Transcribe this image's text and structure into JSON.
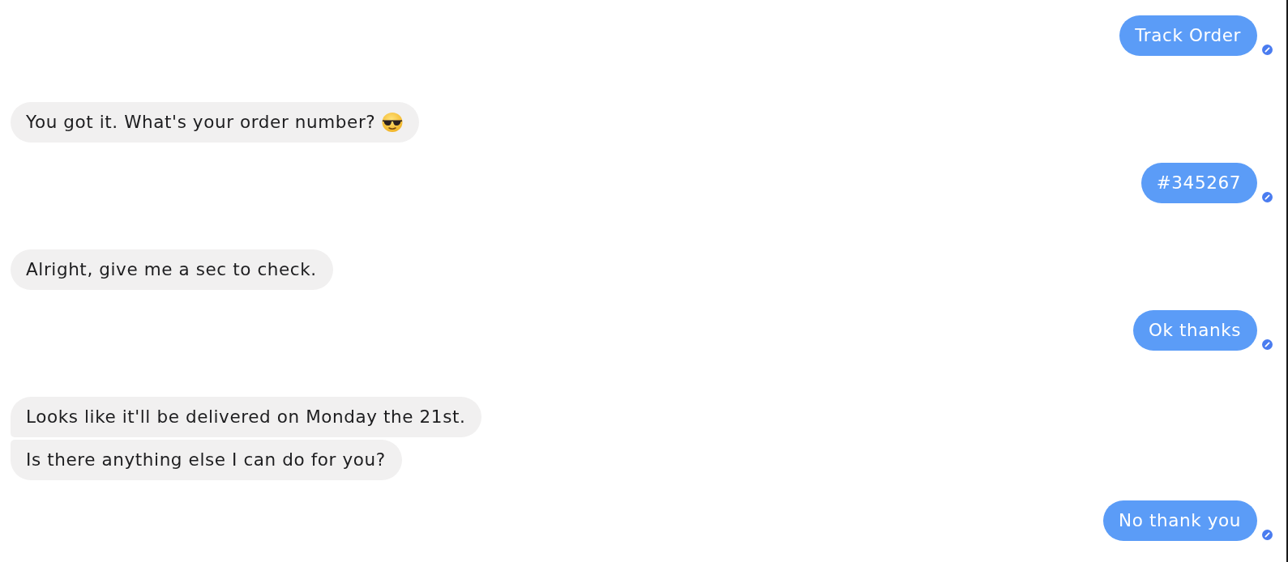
{
  "messages": [
    {
      "kind": "outgoing",
      "text": "Track Order",
      "delivered": true
    },
    {
      "kind": "incoming",
      "text": "You got it. What's your order number?",
      "emoji": true
    },
    {
      "kind": "outgoing",
      "text": "#345267",
      "delivered": true
    },
    {
      "kind": "incoming",
      "text": "Alright, give me a sec to check."
    },
    {
      "kind": "outgoing",
      "text": "Ok thanks",
      "delivered": true
    },
    {
      "kind": "incoming",
      "text": "Looks like it'll be delivered on Monday the 21st."
    },
    {
      "kind": "incoming",
      "text": "Is there anything else I can do for you?"
    },
    {
      "kind": "outgoing",
      "text": "No thank you",
      "delivered": true
    }
  ]
}
